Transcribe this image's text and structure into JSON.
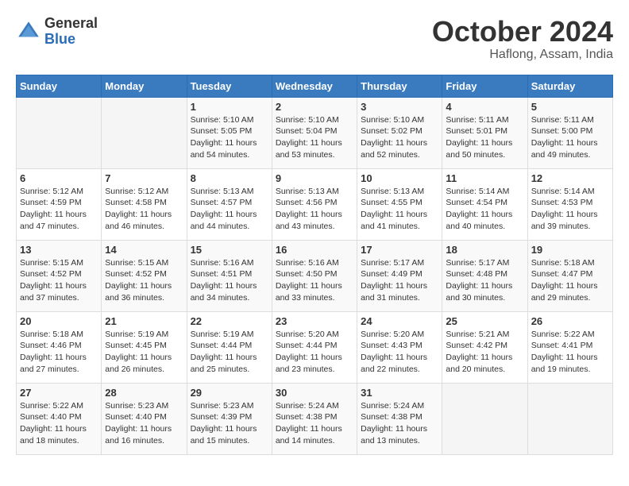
{
  "header": {
    "logo_general": "General",
    "logo_blue": "Blue",
    "month_title": "October 2024",
    "location": "Haflong, Assam, India"
  },
  "weekdays": [
    "Sunday",
    "Monday",
    "Tuesday",
    "Wednesday",
    "Thursday",
    "Friday",
    "Saturday"
  ],
  "weeks": [
    [
      {
        "day": "",
        "info": ""
      },
      {
        "day": "",
        "info": ""
      },
      {
        "day": "1",
        "info": "Sunrise: 5:10 AM\nSunset: 5:05 PM\nDaylight: 11 hours and 54 minutes."
      },
      {
        "day": "2",
        "info": "Sunrise: 5:10 AM\nSunset: 5:04 PM\nDaylight: 11 hours and 53 minutes."
      },
      {
        "day": "3",
        "info": "Sunrise: 5:10 AM\nSunset: 5:02 PM\nDaylight: 11 hours and 52 minutes."
      },
      {
        "day": "4",
        "info": "Sunrise: 5:11 AM\nSunset: 5:01 PM\nDaylight: 11 hours and 50 minutes."
      },
      {
        "day": "5",
        "info": "Sunrise: 5:11 AM\nSunset: 5:00 PM\nDaylight: 11 hours and 49 minutes."
      }
    ],
    [
      {
        "day": "6",
        "info": "Sunrise: 5:12 AM\nSunset: 4:59 PM\nDaylight: 11 hours and 47 minutes."
      },
      {
        "day": "7",
        "info": "Sunrise: 5:12 AM\nSunset: 4:58 PM\nDaylight: 11 hours and 46 minutes."
      },
      {
        "day": "8",
        "info": "Sunrise: 5:13 AM\nSunset: 4:57 PM\nDaylight: 11 hours and 44 minutes."
      },
      {
        "day": "9",
        "info": "Sunrise: 5:13 AM\nSunset: 4:56 PM\nDaylight: 11 hours and 43 minutes."
      },
      {
        "day": "10",
        "info": "Sunrise: 5:13 AM\nSunset: 4:55 PM\nDaylight: 11 hours and 41 minutes."
      },
      {
        "day": "11",
        "info": "Sunrise: 5:14 AM\nSunset: 4:54 PM\nDaylight: 11 hours and 40 minutes."
      },
      {
        "day": "12",
        "info": "Sunrise: 5:14 AM\nSunset: 4:53 PM\nDaylight: 11 hours and 39 minutes."
      }
    ],
    [
      {
        "day": "13",
        "info": "Sunrise: 5:15 AM\nSunset: 4:52 PM\nDaylight: 11 hours and 37 minutes."
      },
      {
        "day": "14",
        "info": "Sunrise: 5:15 AM\nSunset: 4:52 PM\nDaylight: 11 hours and 36 minutes."
      },
      {
        "day": "15",
        "info": "Sunrise: 5:16 AM\nSunset: 4:51 PM\nDaylight: 11 hours and 34 minutes."
      },
      {
        "day": "16",
        "info": "Sunrise: 5:16 AM\nSunset: 4:50 PM\nDaylight: 11 hours and 33 minutes."
      },
      {
        "day": "17",
        "info": "Sunrise: 5:17 AM\nSunset: 4:49 PM\nDaylight: 11 hours and 31 minutes."
      },
      {
        "day": "18",
        "info": "Sunrise: 5:17 AM\nSunset: 4:48 PM\nDaylight: 11 hours and 30 minutes."
      },
      {
        "day": "19",
        "info": "Sunrise: 5:18 AM\nSunset: 4:47 PM\nDaylight: 11 hours and 29 minutes."
      }
    ],
    [
      {
        "day": "20",
        "info": "Sunrise: 5:18 AM\nSunset: 4:46 PM\nDaylight: 11 hours and 27 minutes."
      },
      {
        "day": "21",
        "info": "Sunrise: 5:19 AM\nSunset: 4:45 PM\nDaylight: 11 hours and 26 minutes."
      },
      {
        "day": "22",
        "info": "Sunrise: 5:19 AM\nSunset: 4:44 PM\nDaylight: 11 hours and 25 minutes."
      },
      {
        "day": "23",
        "info": "Sunrise: 5:20 AM\nSunset: 4:44 PM\nDaylight: 11 hours and 23 minutes."
      },
      {
        "day": "24",
        "info": "Sunrise: 5:20 AM\nSunset: 4:43 PM\nDaylight: 11 hours and 22 minutes."
      },
      {
        "day": "25",
        "info": "Sunrise: 5:21 AM\nSunset: 4:42 PM\nDaylight: 11 hours and 20 minutes."
      },
      {
        "day": "26",
        "info": "Sunrise: 5:22 AM\nSunset: 4:41 PM\nDaylight: 11 hours and 19 minutes."
      }
    ],
    [
      {
        "day": "27",
        "info": "Sunrise: 5:22 AM\nSunset: 4:40 PM\nDaylight: 11 hours and 18 minutes."
      },
      {
        "day": "28",
        "info": "Sunrise: 5:23 AM\nSunset: 4:40 PM\nDaylight: 11 hours and 16 minutes."
      },
      {
        "day": "29",
        "info": "Sunrise: 5:23 AM\nSunset: 4:39 PM\nDaylight: 11 hours and 15 minutes."
      },
      {
        "day": "30",
        "info": "Sunrise: 5:24 AM\nSunset: 4:38 PM\nDaylight: 11 hours and 14 minutes."
      },
      {
        "day": "31",
        "info": "Sunrise: 5:24 AM\nSunset: 4:38 PM\nDaylight: 11 hours and 13 minutes."
      },
      {
        "day": "",
        "info": ""
      },
      {
        "day": "",
        "info": ""
      }
    ]
  ]
}
